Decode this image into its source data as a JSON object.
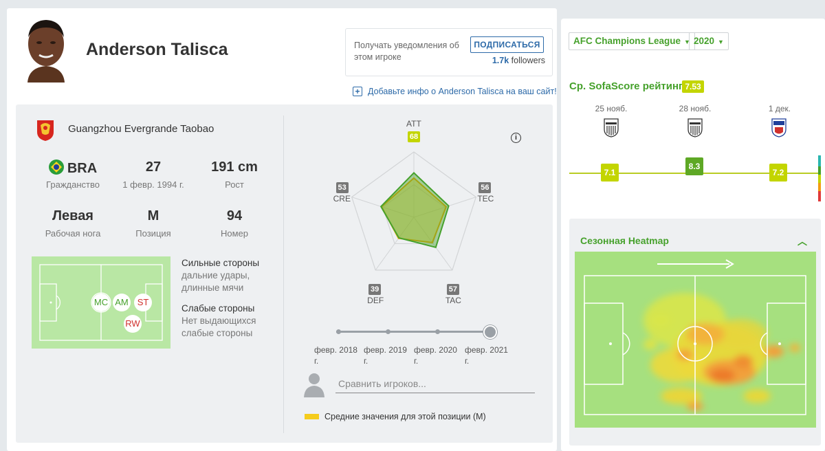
{
  "header": {
    "player_name": "Anderson Talisca",
    "subscribe_text": "Получать уведомления об этом игроке",
    "subscribe_button": "ПОДПИСАТЬСЯ",
    "followers_count": "1.7k",
    "followers_label": "followers",
    "add_info_link": "Добавьте инфо о Anderson Talisca на ваш сайт!"
  },
  "profile": {
    "team": "Guangzhou Evergrande Taobao",
    "stats": [
      {
        "value": "BRA",
        "label": "Гражданство"
      },
      {
        "value": "27",
        "label": "1 февр. 1994 г."
      },
      {
        "value": "191 cm",
        "label": "Рост"
      },
      {
        "value": "Левая",
        "label": "Рабочая нога"
      },
      {
        "value": "M",
        "label": "Позиция"
      },
      {
        "value": "94",
        "label": "Номер"
      }
    ],
    "positions": [
      "MC",
      "AM",
      "ST",
      "RW"
    ],
    "strengths_title": "Сильные стороны",
    "strengths_line1": "дальние удары,",
    "strengths_line2": "длинные мячи",
    "weaknesses_title": "Слабые стороны",
    "weaknesses_line1": "Нет выдающихся",
    "weaknesses_line2": "слабые стороны"
  },
  "chart_data": {
    "type": "radar",
    "axes": [
      "ATT",
      "TEC",
      "TAC",
      "DEF",
      "CRE"
    ],
    "series": [
      {
        "values": [
          68,
          56,
          57,
          39,
          53
        ],
        "color": "#46a12c"
      },
      {
        "name": "Средние значения для этой позиции (M)",
        "values": [
          60,
          52,
          48,
          40,
          52
        ],
        "color": "#f5cc1c"
      }
    ],
    "range": [
      0,
      100
    ],
    "axis_badge_colors": {
      "ATT": "#c3d500",
      "TEC": "#777777",
      "TAC": "#777777",
      "DEF": "#777777",
      "CRE": "#777777"
    }
  },
  "timeline": {
    "labels": [
      "февр. 2018 г.",
      "февр. 2019 г.",
      "февр. 2020 г.",
      "февр. 2021 г."
    ],
    "active_index": 3
  },
  "compare": {
    "placeholder": "Сравнить игроков...",
    "legend": "Средние значения для этой позиции (M)"
  },
  "right": {
    "league_select": "AFC Champions League",
    "season_select": "2020",
    "rating_title": "Ср. SofaScore рейтинг",
    "rating_value": "7.53",
    "matches": [
      {
        "date": "25 нояб.",
        "rating": 7.1,
        "color": "#c3d500"
      },
      {
        "date": "28 нояб.",
        "rating": 8.3,
        "color": "#5ea825"
      },
      {
        "date": "1 дек.",
        "rating": 7.2,
        "color": "#c3d500"
      }
    ],
    "heatmap_title": "Сезонная Heatmap"
  },
  "colors": {
    "accent": "#46a12c",
    "link": "#2d6aa8",
    "rating_yellow": "#c3d500"
  }
}
